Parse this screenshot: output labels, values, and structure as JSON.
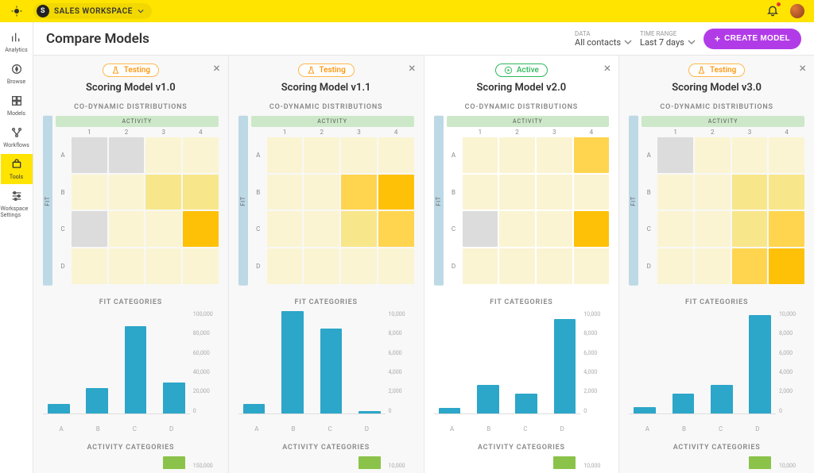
{
  "workspace_label": "SALES WORKSPACE",
  "nav": {
    "items": [
      {
        "key": "analytics",
        "label": "Analytics"
      },
      {
        "key": "browse",
        "label": "Browse"
      },
      {
        "key": "models",
        "label": "Models"
      },
      {
        "key": "workflows",
        "label": "Workflows"
      },
      {
        "key": "tools",
        "label": "Tools"
      },
      {
        "key": "settings",
        "label": "Workspace Settings"
      }
    ],
    "active": "tools"
  },
  "page": {
    "title": "Compare Models",
    "data_filter": {
      "label": "DATA",
      "value": "All contacts"
    },
    "time_filter": {
      "label": "TIME RANGE",
      "value": "Last 7 days"
    },
    "create_btn": "CREATE MODEL"
  },
  "panel_headers": {
    "co_dynamic": "CO-DYNAMIC DISTRIBUTIONS",
    "activity": "ACTIVITY",
    "fit": "FIT",
    "fit_categories": "FIT CATEGORIES",
    "activity_categories": "ACTIVITY CATEGORIES",
    "cols": [
      "1",
      "2",
      "3",
      "4"
    ],
    "rows": [
      "A",
      "B",
      "C",
      "D"
    ]
  },
  "panels": [
    {
      "status": "Testing",
      "name": "Scoring Model v1.0",
      "heatmap_levels": [
        [
          0,
          0,
          1,
          1
        ],
        [
          1,
          1,
          2,
          2
        ],
        [
          0,
          1,
          1,
          4
        ],
        [
          1,
          1,
          1,
          1
        ]
      ],
      "fit_cat": {
        "x": [
          "A",
          "B",
          "C",
          "D"
        ],
        "values": [
          9000,
          25000,
          85000,
          30000
        ],
        "y_ticks": [
          "100,000",
          "80,000",
          "60,000",
          "40,000",
          "20,000",
          "0"
        ],
        "ymax": 100000
      },
      "act_cat": {
        "y_top": "150,000"
      }
    },
    {
      "status": "Testing",
      "name": "Scoring Model v1.1",
      "heatmap_levels": [
        [
          1,
          1,
          1,
          1
        ],
        [
          1,
          1,
          3,
          4
        ],
        [
          1,
          1,
          2,
          3
        ],
        [
          1,
          1,
          1,
          1
        ]
      ],
      "fit_cat": {
        "x": [
          "A",
          "B",
          "C",
          "D"
        ],
        "values": [
          900,
          10000,
          8300,
          200
        ],
        "y_ticks": [
          "10,000",
          "8,000",
          "6,000",
          "4,000",
          "2,000",
          "0"
        ],
        "ymax": 10000
      },
      "act_cat": {
        "y_top": "10,000"
      }
    },
    {
      "status": "Active",
      "name": "Scoring Model v2.0",
      "heatmap_levels": [
        [
          1,
          1,
          1,
          3
        ],
        [
          1,
          1,
          1,
          1
        ],
        [
          0,
          1,
          1,
          4
        ],
        [
          1,
          1,
          1,
          1
        ]
      ],
      "fit_cat": {
        "x": [
          "A",
          "B",
          "C",
          "D"
        ],
        "values": [
          500,
          2800,
          1900,
          9200
        ],
        "y_ticks": [
          "10,000",
          "8,000",
          "6,000",
          "4,000",
          "2,000",
          "0"
        ],
        "ymax": 10000
      },
      "act_cat": {
        "y_top": "10,000"
      }
    },
    {
      "status": "Testing",
      "name": "Scoring Model v3.0",
      "heatmap_levels": [
        [
          0,
          1,
          1,
          1
        ],
        [
          1,
          1,
          2,
          2
        ],
        [
          1,
          1,
          2,
          3
        ],
        [
          1,
          1,
          3,
          4
        ]
      ],
      "fit_cat": {
        "x": [
          "A",
          "B",
          "C",
          "D"
        ],
        "values": [
          600,
          1900,
          2800,
          9600
        ],
        "y_ticks": [
          "10,000",
          "8,000",
          "6,000",
          "4,000",
          "2,000",
          "0"
        ],
        "ymax": 10000
      },
      "act_cat": {
        "y_top": "10,000"
      }
    }
  ],
  "heat_palette": [
    "#dcdcdc",
    "#fbf4d2",
    "#f8e68a",
    "#ffd54f",
    "#ffc107"
  ],
  "chart_data": [
    {
      "type": "heatmap",
      "panel": 0,
      "x_labels": [
        "1",
        "2",
        "3",
        "4"
      ],
      "y_labels": [
        "A",
        "B",
        "C",
        "D"
      ],
      "levels": [
        [
          0,
          0,
          1,
          1
        ],
        [
          1,
          1,
          2,
          2
        ],
        [
          0,
          1,
          1,
          4
        ],
        [
          1,
          1,
          1,
          1
        ]
      ],
      "title": "CO-DYNAMIC DISTRIBUTIONS",
      "xlabel": "ACTIVITY",
      "ylabel": "FIT"
    },
    {
      "type": "bar",
      "panel": 0,
      "categories": [
        "A",
        "B",
        "C",
        "D"
      ],
      "values": [
        9000,
        25000,
        85000,
        30000
      ],
      "title": "FIT CATEGORIES",
      "ylim": [
        0,
        100000
      ]
    },
    {
      "type": "heatmap",
      "panel": 1,
      "x_labels": [
        "1",
        "2",
        "3",
        "4"
      ],
      "y_labels": [
        "A",
        "B",
        "C",
        "D"
      ],
      "levels": [
        [
          1,
          1,
          1,
          1
        ],
        [
          1,
          1,
          3,
          4
        ],
        [
          1,
          1,
          2,
          3
        ],
        [
          1,
          1,
          1,
          1
        ]
      ],
      "title": "CO-DYNAMIC DISTRIBUTIONS",
      "xlabel": "ACTIVITY",
      "ylabel": "FIT"
    },
    {
      "type": "bar",
      "panel": 1,
      "categories": [
        "A",
        "B",
        "C",
        "D"
      ],
      "values": [
        900,
        10000,
        8300,
        200
      ],
      "title": "FIT CATEGORIES",
      "ylim": [
        0,
        10000
      ]
    },
    {
      "type": "heatmap",
      "panel": 2,
      "x_labels": [
        "1",
        "2",
        "3",
        "4"
      ],
      "y_labels": [
        "A",
        "B",
        "C",
        "D"
      ],
      "levels": [
        [
          1,
          1,
          1,
          3
        ],
        [
          1,
          1,
          1,
          1
        ],
        [
          0,
          1,
          1,
          4
        ],
        [
          1,
          1,
          1,
          1
        ]
      ],
      "title": "CO-DYNAMIC DISTRIBUTIONS",
      "xlabel": "ACTIVITY",
      "ylabel": "FIT"
    },
    {
      "type": "bar",
      "panel": 2,
      "categories": [
        "A",
        "B",
        "C",
        "D"
      ],
      "values": [
        500,
        2800,
        1900,
        9200
      ],
      "title": "FIT CATEGORIES",
      "ylim": [
        0,
        10000
      ]
    },
    {
      "type": "heatmap",
      "panel": 3,
      "x_labels": [
        "1",
        "2",
        "3",
        "4"
      ],
      "y_labels": [
        "A",
        "B",
        "C",
        "D"
      ],
      "levels": [
        [
          0,
          1,
          1,
          1
        ],
        [
          1,
          1,
          2,
          2
        ],
        [
          1,
          1,
          2,
          3
        ],
        [
          1,
          1,
          3,
          4
        ]
      ],
      "title": "CO-DYNAMIC DISTRIBUTIONS",
      "xlabel": "ACTIVITY",
      "ylabel": "FIT"
    },
    {
      "type": "bar",
      "panel": 3,
      "categories": [
        "A",
        "B",
        "C",
        "D"
      ],
      "values": [
        600,
        1900,
        2800,
        9600
      ],
      "title": "FIT CATEGORIES",
      "ylim": [
        0,
        10000
      ]
    }
  ]
}
